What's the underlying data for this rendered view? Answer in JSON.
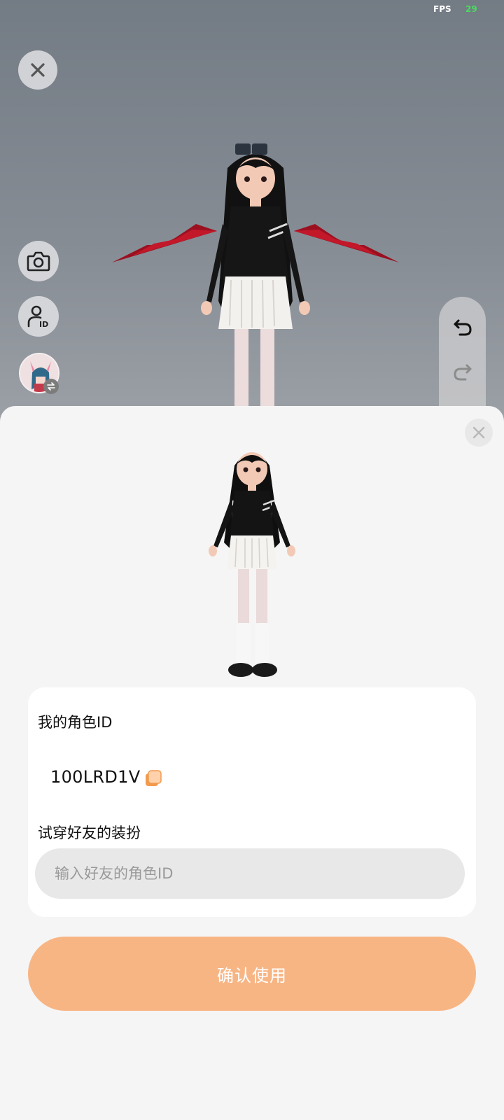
{
  "status": {
    "fps_label": "FPS",
    "fps_value": "29"
  },
  "scene": {
    "close_icon": "close-icon",
    "camera_icon": "camera-icon",
    "id_icon": "user-id-icon",
    "switch_icon": "swap-icon",
    "undo_icon": "undo-icon",
    "redo_icon": "redo-icon"
  },
  "sheet": {
    "my_id_label": "我的角色ID",
    "my_id_value": "100LRD1V",
    "try_label": "试穿好友的装扮",
    "friend_input_placeholder": "输入好友的角色ID",
    "friend_input_value": "",
    "confirm_label": "确认使用"
  },
  "colors": {
    "accent": "#f8b584",
    "fps_value": "#4cd964",
    "copy_icon": "#f29a4e"
  }
}
